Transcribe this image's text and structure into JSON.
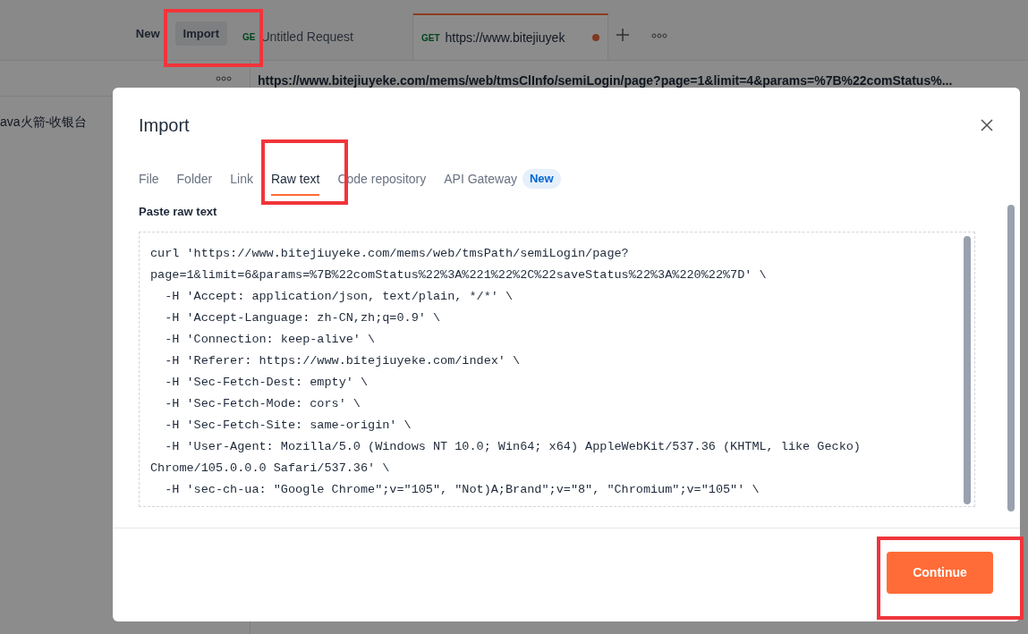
{
  "app": {
    "toolbar_buttons": [
      "New",
      "Import"
    ],
    "tabs": [
      {
        "method": "GE",
        "title": "Untitled Request",
        "selected": false,
        "unsaved": false
      },
      {
        "method": "GET",
        "title": "https://www.bitejiuyek",
        "selected": true,
        "unsaved": true
      }
    ],
    "url": "https://www.bitejiuyeke.com/mems/web/tmsClInfo/semiLogin/page?page=1&limit=4&params=%7B%22comStatus%...",
    "sidebar_item": "ava火箭-收银台"
  },
  "dialog": {
    "title": "Import",
    "tabs": [
      {
        "label": "File",
        "selected": false
      },
      {
        "label": "Folder",
        "selected": false
      },
      {
        "label": "Link",
        "selected": false
      },
      {
        "label": "Raw text",
        "selected": true
      },
      {
        "label": "Code repository",
        "selected": false
      },
      {
        "label": "API Gateway",
        "selected": false,
        "badge": "New"
      }
    ],
    "section_label": "Paste raw text",
    "raw_text": [
      "curl 'https://www.bitejiuyeke.com/mems/web/tmsPath/semiLogin/page?",
      "page=1&limit=6&params=%7B%22comStatus%22%3A%221%22%2C%22saveStatus%22%3A%220%22%7D' \\",
      "  -H 'Accept: application/json, text/plain, */*' \\",
      "  -H 'Accept-Language: zh-CN,zh;q=0.9' \\",
      "  -H 'Connection: keep-alive' \\",
      "  -H 'Referer: https://www.bitejiuyeke.com/index' \\",
      "  -H 'Sec-Fetch-Dest: empty' \\",
      "  -H 'Sec-Fetch-Mode: cors' \\",
      "  -H 'Sec-Fetch-Site: same-origin' \\",
      "  -H 'User-Agent: Mozilla/5.0 (Windows NT 10.0; Win64; x64) AppleWebKit/537.36 (KHTML, like Gecko)",
      "Chrome/105.0.0.0 Safari/537.36' \\",
      "  -H 'sec-ch-ua: \"Google Chrome\";v=\"105\", \"Not)A;Brand\";v=\"8\", \"Chromium\";v=\"105\"' \\"
    ],
    "primary_button": "Continue"
  }
}
